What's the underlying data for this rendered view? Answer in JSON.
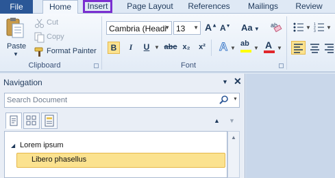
{
  "ribbon": {
    "tabs": {
      "file": "File",
      "home": "Home",
      "insert": "Insert",
      "page_layout": "Page Layout",
      "references": "References",
      "mailings": "Mailings",
      "review": "Review"
    },
    "clipboard": {
      "paste": "Paste",
      "cut": "Cut",
      "copy": "Copy",
      "format_painter": "Format Painter",
      "group_label": "Clipboard"
    },
    "font": {
      "font_name": "Cambria (Headi",
      "font_size": "13",
      "group_label": "Font",
      "bold": "B",
      "italic": "I",
      "underline": "U",
      "strikethrough": "abc",
      "subscript": "x₂",
      "superscript": "x²",
      "grow": "A",
      "shrink": "A",
      "change_case": "Aa",
      "text_effects": "A",
      "highlight": "ab",
      "font_color": "A"
    },
    "colors": {
      "file_tab": "#2b5797",
      "insert_outline": "#7a2fd0",
      "active_button": "#fbe28f",
      "font_color_bar": "#e0262b",
      "highlight_bar": "#ffff00"
    }
  },
  "navigation": {
    "title": "Navigation",
    "search_placeholder": "Search Document",
    "tree": [
      {
        "label": "Lorem ipsum",
        "level": 1,
        "expanded": true
      },
      {
        "label": "Libero phasellus",
        "level": 2,
        "selected": true
      }
    ]
  }
}
